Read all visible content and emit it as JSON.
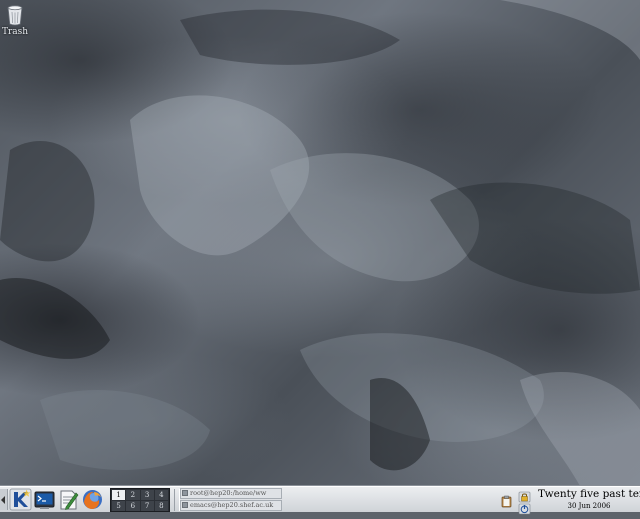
{
  "desktop": {
    "icons": [
      {
        "label": "Trash",
        "icon": "trash-icon"
      }
    ]
  },
  "taskbar": {
    "launchers": [
      {
        "icon": "kde-menu-icon"
      },
      {
        "icon": "terminal-icon"
      },
      {
        "icon": "text-editor-icon"
      },
      {
        "icon": "firefox-icon"
      }
    ],
    "pager": {
      "desktops": [
        "1",
        "2",
        "3",
        "4",
        "5",
        "6",
        "7",
        "8"
      ],
      "active": "1"
    },
    "tasks": [
      {
        "title": "root@hep20:/home/ww",
        "icon": "terminal-icon"
      },
      {
        "title": "emacs@hep20.shef.ac.uk",
        "icon": "emacs-icon"
      }
    ],
    "tray": [
      {
        "icon": "clipboard-icon"
      },
      {
        "icon": "lock-screen-icon"
      },
      {
        "icon": "logout-icon"
      }
    ],
    "clock": {
      "time": "Twenty five past ten",
      "date": "30 Jun 2006"
    }
  }
}
